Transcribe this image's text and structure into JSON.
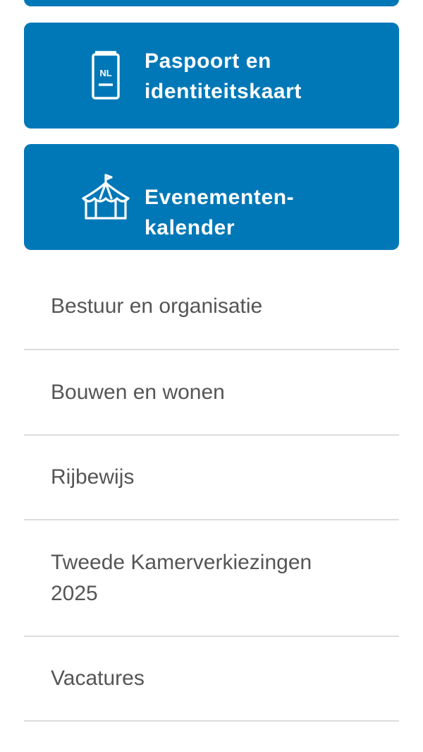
{
  "tiles": [
    {
      "label": "Paspoort en identiteitskaart",
      "icon": "passport-nl-icon"
    },
    {
      "label": "Evenementen-kalender",
      "icon": "tent-icon"
    }
  ],
  "menu": [
    {
      "label": "Bestuur en organisatie"
    },
    {
      "label": "Bouwen en wonen"
    },
    {
      "label": "Rijbewijs"
    },
    {
      "label": "Tweede Kamerverkiezingen 2025"
    },
    {
      "label": "Vacatures"
    }
  ],
  "passport_icon_text": "NL",
  "colors": {
    "tile_background": "#0078b8",
    "tile_text": "#ffffff",
    "list_text": "#555555",
    "divider": "#dcdcdc"
  }
}
